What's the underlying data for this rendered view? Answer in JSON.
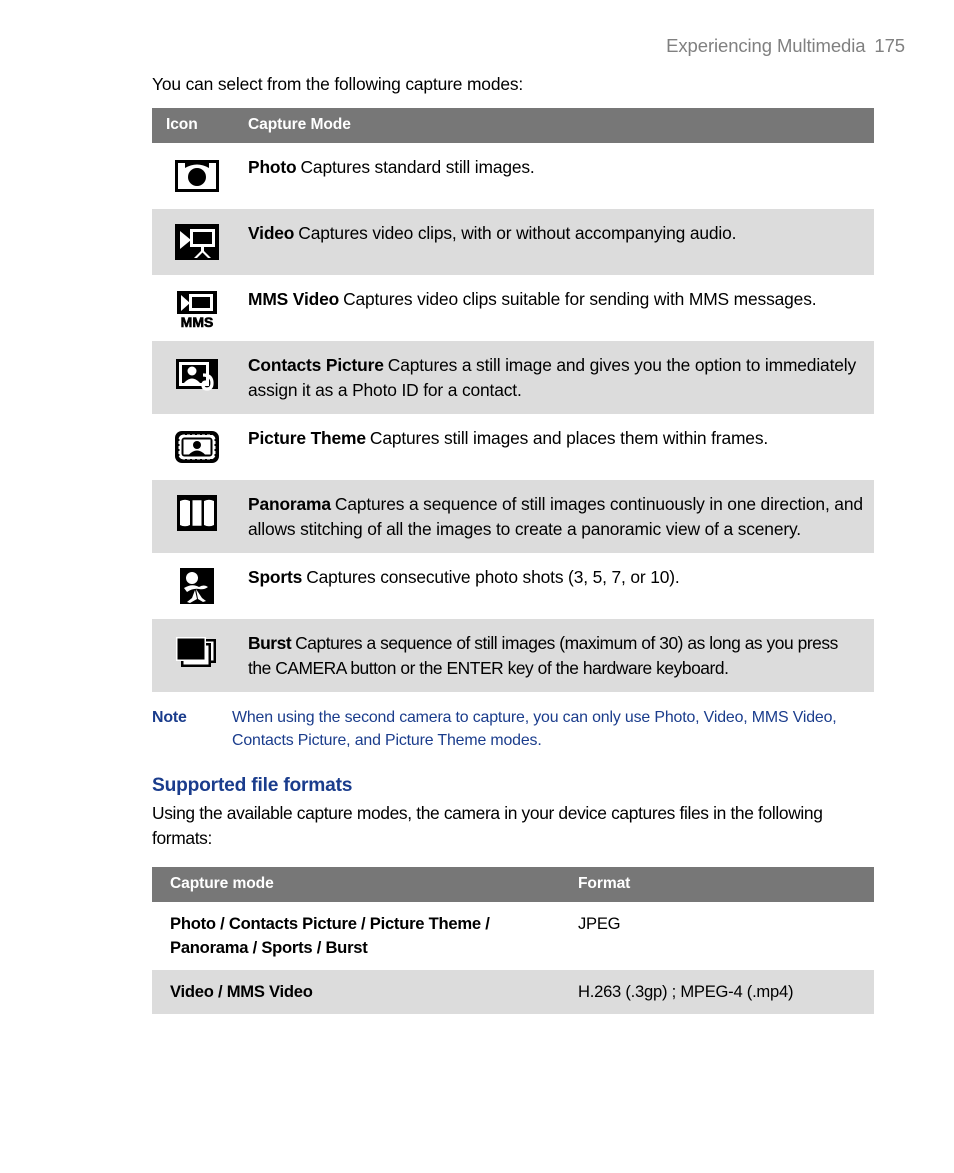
{
  "header": {
    "chapter_title": "Experiencing Multimedia",
    "page_number": "175"
  },
  "intro": {
    "text": "You can select from the following capture modes:"
  },
  "modes_table": {
    "columns": {
      "icon": "Icon",
      "mode": "Capture Mode"
    },
    "rows": [
      {
        "icon": "camera-photo-icon",
        "name": "Photo",
        "description": "Captures standard still images."
      },
      {
        "icon": "video-camera-icon",
        "name": "Video",
        "description": "Captures video clips, with or without accompanying audio."
      },
      {
        "icon": "mms-video-icon",
        "name": "MMS Video",
        "description": "Captures video clips suitable for sending with MMS messages."
      },
      {
        "icon": "contacts-picture-icon",
        "name": "Contacts Picture",
        "description": "Captures a still image and gives you the option to immediately assign it as a Photo ID for a contact."
      },
      {
        "icon": "picture-theme-icon",
        "name": "Picture Theme",
        "description": "Captures still images and places them within frames."
      },
      {
        "icon": "panorama-icon",
        "name": "Panorama",
        "description": "Captures a sequence of still images continuously in one direction, and allows stitching of all the images to create a panoramic view of a scenery."
      },
      {
        "icon": "sports-icon",
        "name": "Sports",
        "description": "Captures consecutive photo shots (3, 5, 7, or 10)."
      },
      {
        "icon": "burst-icon",
        "name": "Burst",
        "description": "Captures a sequence of still images (maximum of 30) as long as you press the CAMERA button or the ENTER key of the hardware keyboard."
      }
    ]
  },
  "note": {
    "label": "Note",
    "text": "When using the second camera to capture, you can only use Photo, Video, MMS Video, Contacts Picture, and Picture Theme modes."
  },
  "section": {
    "heading": "Supported file formats",
    "body": "Using the available capture modes, the camera in your device captures files in the following formats:"
  },
  "formats_table": {
    "columns": {
      "mode": "Capture mode",
      "format": "Format"
    },
    "rows": [
      {
        "mode": "Photo / Contacts Picture / Picture Theme / Panorama / Sports / Burst",
        "format": "JPEG"
      },
      {
        "mode": "Video / MMS Video",
        "format": "H.263 (.3gp) ; MPEG-4 (.mp4)"
      }
    ]
  },
  "colors": {
    "table_header_bg": "#777777",
    "row_shade_bg": "#dcdcdc",
    "note_blue": "#1a3c8c",
    "running_header_gray": "#808080",
    "body_text": "#000000"
  }
}
